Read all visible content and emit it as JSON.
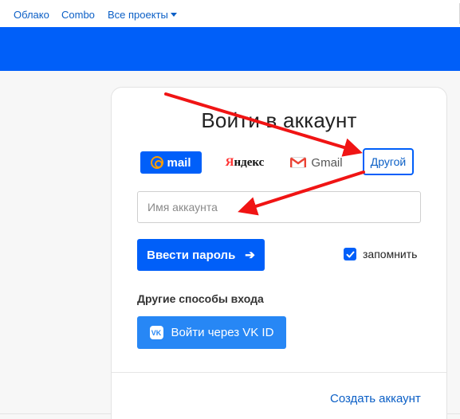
{
  "topnav": {
    "links": [
      "Облако",
      "Combo",
      "Все проекты"
    ]
  },
  "card": {
    "title": "Войти в аккаунт",
    "providers": {
      "mail": "mail",
      "yandex_y": "Я",
      "yandex_rest": "ндекс",
      "gmail": "Gmail",
      "other": "Другой"
    },
    "account_input": {
      "placeholder": "Имя аккаунта",
      "value": ""
    },
    "enter_password_label": "Ввести пароль",
    "enter_password_arrow": "➔",
    "remember_label": "запомнить",
    "remember_checked": true,
    "other_methods_label": "Другие способы входа",
    "vk_login_label": "Войти через VK ID",
    "create_account_label": "Создать аккаунт"
  },
  "colors": {
    "brand_blue": "#005ff9",
    "vk_blue": "#2787f5",
    "annotation_red": "#f01414",
    "mail_orange": "#ff9e00"
  },
  "icons": [
    "at-sign-icon",
    "gmail-icon",
    "arrow-right-icon",
    "checkmark-icon",
    "vk-icon",
    "chevron-down-icon"
  ]
}
